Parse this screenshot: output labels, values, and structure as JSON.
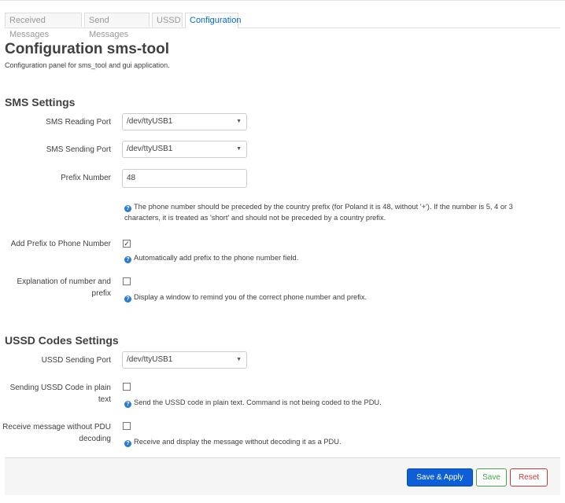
{
  "tabs": [
    {
      "label": "Received Messages"
    },
    {
      "label": "Send Messages"
    },
    {
      "label": "USSD"
    },
    {
      "label": "Configuration"
    }
  ],
  "page": {
    "title": "Configuration sms-tool",
    "description": "Configuration panel for sms_tool and gui application."
  },
  "sms": {
    "heading": "SMS Settings",
    "reading_port": {
      "label": "SMS Reading Port",
      "value": "/dev/ttyUSB1"
    },
    "sending_port": {
      "label": "SMS Sending Port",
      "value": "/dev/ttyUSB1"
    },
    "prefix": {
      "label": "Prefix Number",
      "value": "48",
      "help_line1": "The phone number should be preceded by the country prefix (for Poland it is 48, without '+'). If the number is 5, 4 or 3",
      "help_line2": "characters, it is treated as 'short' and should not be preceded by a country prefix."
    },
    "add_prefix": {
      "label": "Add Prefix to Phone Number",
      "checked": true,
      "help": "Automatically add prefix to the phone number field."
    },
    "explanation": {
      "label_line1": "Explanation of number and",
      "label_line2": "prefix",
      "checked": false,
      "help": "Display a window to remind you of the correct phone number and prefix."
    }
  },
  "ussd": {
    "heading": "USSD Codes Settings",
    "sending_port": {
      "label": "USSD Sending Port",
      "value": "/dev/ttyUSB1"
    },
    "plain_text": {
      "label_line1": "Sending USSD Code in plain",
      "label_line2": "text",
      "checked": false,
      "help": "Send the USSD code in plain text. Command is not being coded to the PDU."
    },
    "no_pdu": {
      "label_line1": "Receive message without PDU",
      "label_line2": "decoding",
      "checked": false,
      "help": "Receive and display the message without decoding it as a PDU."
    }
  },
  "footer": {
    "save_apply": "Save & Apply",
    "save": "Save",
    "reset": "Reset"
  },
  "icons": {
    "help": "info-icon",
    "dropdown": "chevron-down-icon",
    "check": "checkmark-icon"
  },
  "colors": {
    "accent": "#0d5fd8",
    "save": "#46a546",
    "reset": "#c43c35",
    "help_icon": "#2a7ad6"
  }
}
